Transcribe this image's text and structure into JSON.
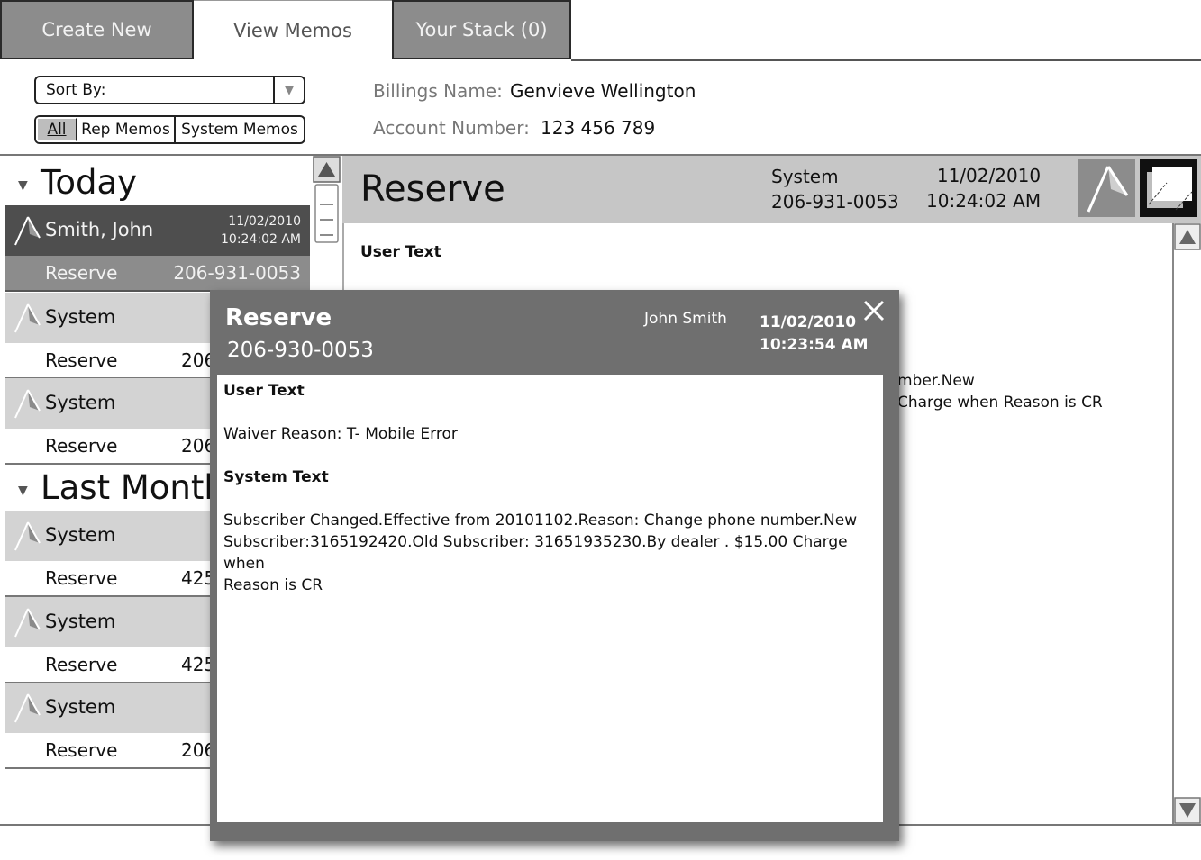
{
  "tabs": [
    {
      "label": "Create New",
      "active": false
    },
    {
      "label": "View Memos",
      "active": true
    },
    {
      "label": "Your Stack (0)",
      "active": false
    }
  ],
  "sort": {
    "label": "Sort By:",
    "value": ""
  },
  "filters": {
    "all": "All",
    "rep": "Rep Memos",
    "system": "System Memos",
    "selected": "All"
  },
  "account": {
    "billing_label": "Billings Name:",
    "billing_value": "Genvieve Wellington",
    "account_label": "Account Number:",
    "account_value": "123 456 789"
  },
  "memo_list": {
    "sections": [
      {
        "title": "Today",
        "items": [
          {
            "name": "Smith, John",
            "date": "11/02/2010",
            "time": "10:24:02 AM",
            "type": "Reserve",
            "phone": "206-931-0053",
            "selected": true
          },
          {
            "name": "System",
            "type": "Reserve",
            "phone": "206",
            "selected": false
          },
          {
            "name": "System",
            "type": "Reserve",
            "phone": "206",
            "selected": false
          }
        ]
      },
      {
        "title": "Last Month",
        "items": [
          {
            "name": "System",
            "type": "Reserve",
            "phone": "425",
            "selected": false
          },
          {
            "name": "System",
            "type": "Reserve",
            "phone": "425",
            "selected": false
          },
          {
            "name": "System",
            "type": "Reserve",
            "phone": "206",
            "selected": false
          }
        ]
      }
    ]
  },
  "detail": {
    "title": "Reserve",
    "author": "System",
    "phone": "206-931-0053",
    "date": "11/02/2010",
    "time": "10:24:02 AM",
    "user_text_label": "User Text",
    "peek_line1": "mber.New",
    "peek_line2": "Charge when Reason is CR"
  },
  "popup": {
    "title": "Reserve",
    "phone": "206-930-0053",
    "author": "John Smith",
    "date": "11/02/2010",
    "time": "10:23:54 AM",
    "user_text_label": "User Text",
    "user_text": "Waiver Reason: T- Mobile Error",
    "system_text_label": "System Text",
    "system_text_line1": "Subscriber Changed.Effective from 20101102.Reason: Change phone number.New",
    "system_text_line2": "Subscriber:3165192420.Old Subscriber: 31651935230.By dealer . $15.00 Charge when",
    "system_text_line3": "Reason is CR"
  },
  "icons": {
    "flag": "flag-icon",
    "expand": "expand-window-icon",
    "close": "close-icon",
    "scroll_up": "arrow-up-icon",
    "scroll_down": "arrow-down-icon"
  },
  "colors": {
    "tab_inactive": "#8c8c8c",
    "header_gray": "#c6c6c6",
    "selected_row": "#4e4e4e",
    "popup_frame": "#6f6f6f"
  }
}
